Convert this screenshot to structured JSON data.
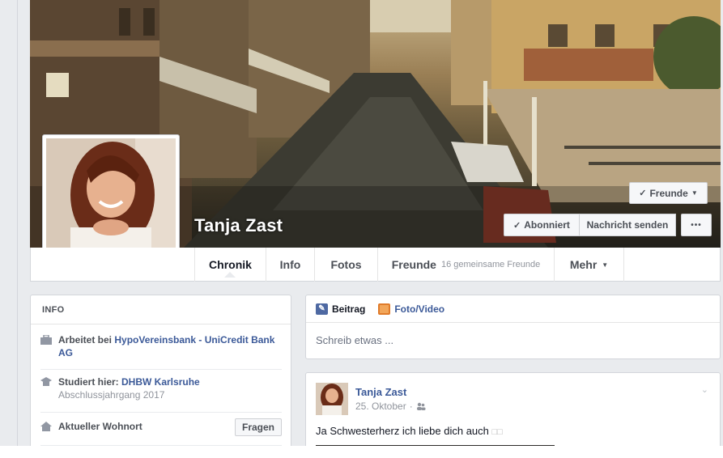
{
  "profile": {
    "name": "Tanja Zast"
  },
  "cover_buttons": {
    "friends": "Freunde",
    "subscribed": "Abonniert",
    "message": "Nachricht senden",
    "more": "•••"
  },
  "tabs": [
    {
      "label": "Chronik"
    },
    {
      "label": "Info"
    },
    {
      "label": "Fotos"
    },
    {
      "label": "Freunde",
      "sub": "16 gemeinsame Freunde"
    },
    {
      "label": "Mehr"
    }
  ],
  "info": {
    "title": "INFO",
    "work_prefix": "Arbeitet bei ",
    "work_link": "HypoVereinsbank - UniCredit Bank AG",
    "study_prefix": "Studiert hier: ",
    "study_link": "DHBW Karlsruhe",
    "study_sub": "Abschlussjahrgang 2017",
    "location_label": "Aktueller Wohnort",
    "ask_button": "Fragen"
  },
  "composer": {
    "tab_post": "Beitrag",
    "tab_photo": "Foto/Video",
    "placeholder": "Schreib etwas ..."
  },
  "post": {
    "author": "Tanja Zast",
    "date": "25. Oktober",
    "separator": "·",
    "text": "Ja Schwesterherz ich liebe dich auch",
    "text_emoji": "□□"
  },
  "colors": {
    "brand_link": "#3b5998",
    "background": "#e9ebee"
  }
}
